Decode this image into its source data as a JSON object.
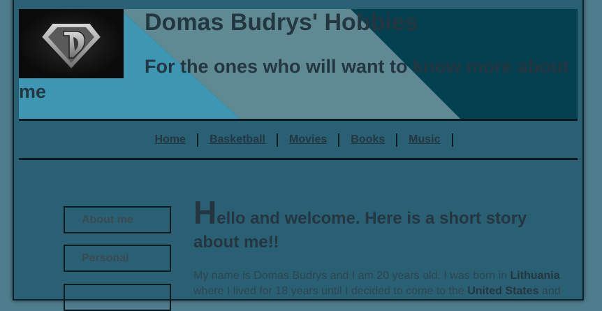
{
  "header": {
    "title": "Domas Budrys' Hobbies",
    "tagline": "For the ones who will want to know more about me",
    "logo_icon": "superman-d-logo-icon",
    "colors": {
      "band_light": "#3d97b3",
      "band_mid": "#5f8a94",
      "band_dark": "#04404f"
    }
  },
  "nav": {
    "items": [
      {
        "label": "Home"
      },
      {
        "label": "Basketball"
      },
      {
        "label": "Movies"
      },
      {
        "label": "Books"
      },
      {
        "label": "Music"
      }
    ]
  },
  "sidebar": {
    "items": [
      {
        "label": "About me"
      },
      {
        "label": "Personal"
      },
      {
        "label": ""
      }
    ]
  },
  "main": {
    "welcome_initial": "H",
    "welcome_rest": "ello and welcome. Here is a short story about me!!",
    "intro_before": "My name is Domas Budrys and I am 20 years old. I was born in ",
    "intro_country": "Lithuania",
    "intro_after": " where I lived for 18 years until I decided to come to the ",
    "intro_us": "United States",
    "intro_end": " and"
  }
}
